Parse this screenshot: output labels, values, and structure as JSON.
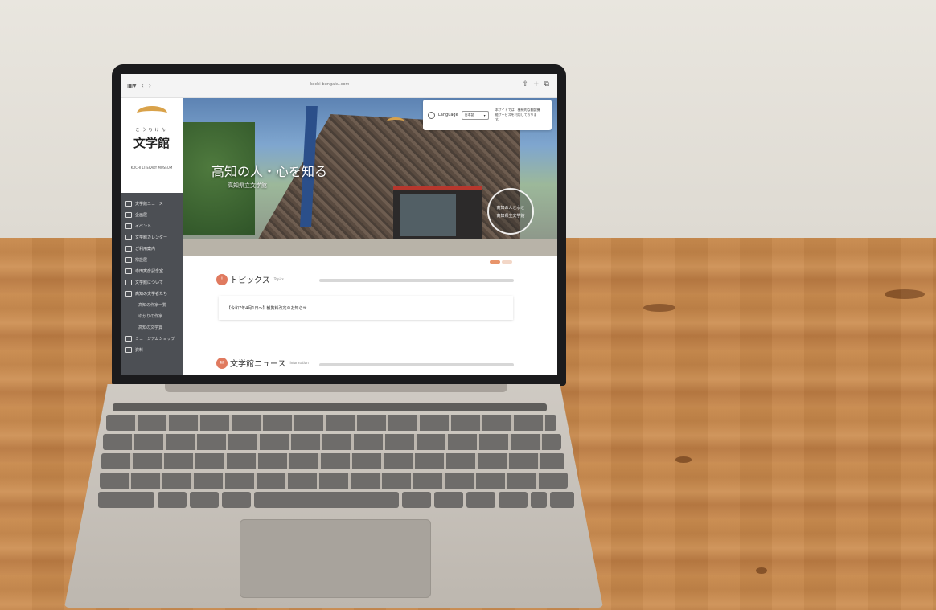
{
  "browser": {
    "url": "kochi-bungaku.com"
  },
  "sidebar": {
    "logo_small": "こうちけん",
    "logo_big": "文学館",
    "logo_en": "KOCHI LITERARY MUSEUM",
    "items": [
      {
        "label": "文学館ニュース",
        "sub": false
      },
      {
        "label": "企画展",
        "sub": false
      },
      {
        "label": "イベント",
        "sub": false
      },
      {
        "label": "文学館カレンダー",
        "sub": false
      },
      {
        "label": "ご利用案内",
        "sub": false
      },
      {
        "label": "常設展",
        "sub": false
      },
      {
        "label": "寺田寅彦記念室",
        "sub": false
      },
      {
        "label": "文学館について",
        "sub": false
      },
      {
        "label": "高知の文学者たち",
        "sub": false
      },
      {
        "label": "高知の作家一覧",
        "sub": true
      },
      {
        "label": "ゆかりの作家",
        "sub": true
      },
      {
        "label": "高知の文学賞",
        "sub": true
      },
      {
        "label": "ミュージアムショップ",
        "sub": false
      },
      {
        "label": "資料",
        "sub": false
      }
    ]
  },
  "hero": {
    "headline": "高知の人・心を知る",
    "subline": "高知県立文学館",
    "badge_line1": "高知の人と心と",
    "badge_line2": "高知県立文学館"
  },
  "language": {
    "label": "Language",
    "selected": "日本語",
    "note": "本サイトでは、機械的な翻訳機能サービスを利用しております。"
  },
  "topics": {
    "title": "トピックス",
    "en": "Topics",
    "item": "【令和7年4月1日〜】観覧料改定のお知らせ"
  },
  "news": {
    "title": "文学館ニュース",
    "en": "Information"
  }
}
